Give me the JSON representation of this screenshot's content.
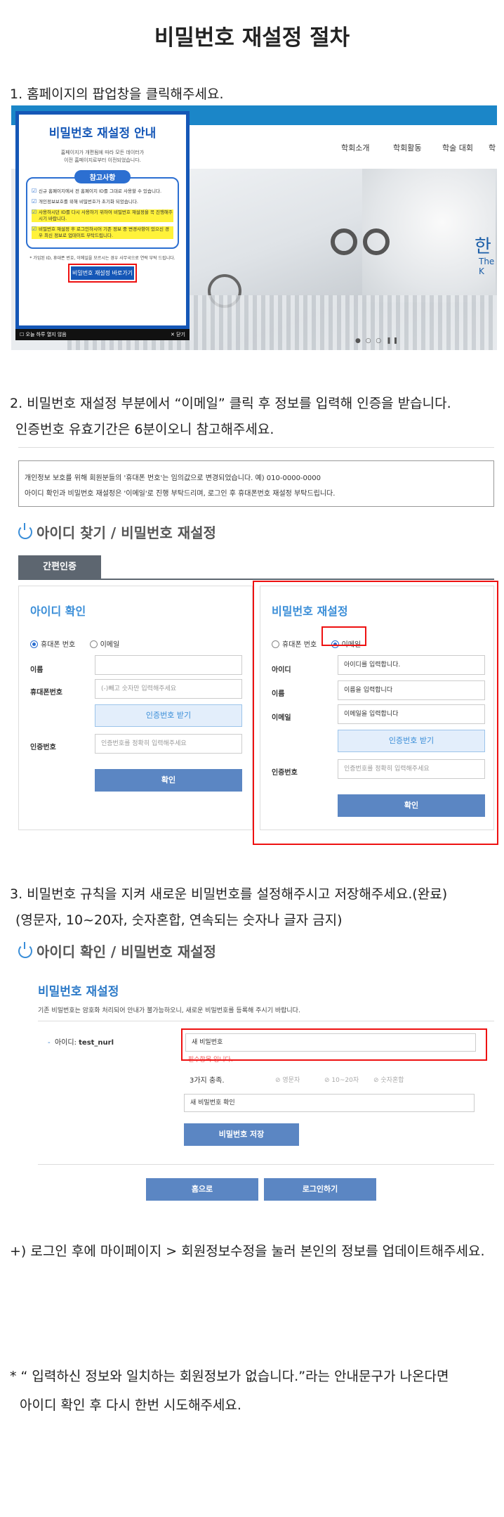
{
  "page": {
    "title": "비밀번호 재설정 절차"
  },
  "step1": {
    "text": "1. 홈페이지의 팝업창을 클릭해주세요.",
    "site": {
      "nav": [
        "학회소개",
        "학회활동",
        "학술 대회",
        "학"
      ],
      "hero_text": "한",
      "hero_sub": "The K"
    },
    "popup": {
      "title": "비밀번호 재설정 안내",
      "intro": [
        "홈페이지가 개편됨에 따라 모든 데이터가",
        "이전 홈페이지로부터 이전되었습니다."
      ],
      "note_title": "참고사항",
      "notes": [
        "신규 홈페이지에서 전 홈페이지 ID를 그대로 사용할 수 있습니다.",
        "개인정보보호를 위해 비밀번호가 초기화 되었습니다.",
        "사용하시던 ID를 다시 사용하기 위하여 비밀번호 재설정을 꼭 진행해주시기 바랍니다.",
        "비밀번호 재설정 후 로그인하시어 기존 정보 중 변경사항이 있으신 경우 최신 정보로 업데이트 부탁드립니다."
      ],
      "footnote": "* 가입된 ID, 휴대폰 번호, 이메일을 모르시는 경우 사무국으로 연락 부탁 드립니다.",
      "button": "비밀번호 재설정 바로가기",
      "footer_left": "오늘 하루 열지 않음",
      "footer_right": "✕ 닫기"
    }
  },
  "step2": {
    "line1": "2. 비밀번호 재설정 부분에서 “이메일” 클릭 후 정보를 입력해 인증을 받습니다.",
    "line2": "인증번호 유효기간은 6분이오니 참고해주세요.",
    "info": [
      "개인정보 보호를 위해 회원분들의 '휴대폰 번호'는 임의값으로 변경되었습니다. 예) 010-0000-0000",
      "아이디 확인과 비밀번호 재설정은 '이메일'로 진행 부탁드리며, 로그인 후 휴대폰번호 재설정 부탁드립니다."
    ],
    "heading": "아이디 찾기 / 비밀번호 재설정",
    "tab": "간편인증",
    "left": {
      "title": "아이디 확인",
      "radio_phone": "휴대폰 번호",
      "radio_email": "이메일",
      "label_name": "이름",
      "label_phone": "휴대폰번호",
      "phone_placeholder": "(-)빼고 숫자만 입력해주세요",
      "verify_button": "인증번호 받기",
      "label_code": "인증번호",
      "code_placeholder": "인증번호를 정확히 입력해주세요",
      "confirm": "확인"
    },
    "right": {
      "title": "비밀번호 재설정",
      "radio_phone": "휴대폰 번호",
      "radio_email": "이메일",
      "label_id": "아이디",
      "id_placeholder": "아이디를 입력합니다.",
      "label_name": "이름",
      "name_placeholder": "이름을 입력합니다",
      "label_email": "이메일",
      "email_placeholder": "이메일을 입력합니다",
      "verify_button": "인증번호 받기",
      "label_code": "인증번호",
      "code_placeholder": "인증번호를 정확히 입력해주세요",
      "confirm": "확인"
    }
  },
  "step3": {
    "line1": "3. 비밀번호 규칙을 지켜 새로운 비밀번호를 설정해주시고 저장해주세요.(완료)",
    "line2": "(영문자, 10~20자, 숫자혼합, 연속되는 숫자나 글자 금지)",
    "heading": "아이디 확인 / 비밀번호 재설정",
    "title": "비밀번호 재설정",
    "desc": "기존 비밀번호는 암호화 처리되어 안내가 불가능하오니, 새로운 비밀번호를 등록해 주시기 바랍니다.",
    "id_label": "아이디:",
    "id_value": "test_nurl",
    "new_pw_placeholder": "새 비밀번호",
    "warning": "필수항목 입니다.",
    "rule_label": "3가지 충족.",
    "rules": [
      "영문자",
      "10~20자",
      "숫자혼합"
    ],
    "confirm_placeholder": "새 비밀번호 확인",
    "save_button": "비밀번호 저장",
    "home_button": "홈으로",
    "login_button": "로그인하기"
  },
  "extra": {
    "update_note": "+) 로그인 후에 마이페이지 > 회원정보수정을 눌러 본인의 정보를 업데이트해주세요.",
    "warn1": "* “ 입력하신 정보와 일치하는 회원정보가 없습니다.”라는 안내문구가 나온다면",
    "warn2": "아이디 확인 후 다시 한번 시도해주세요."
  }
}
